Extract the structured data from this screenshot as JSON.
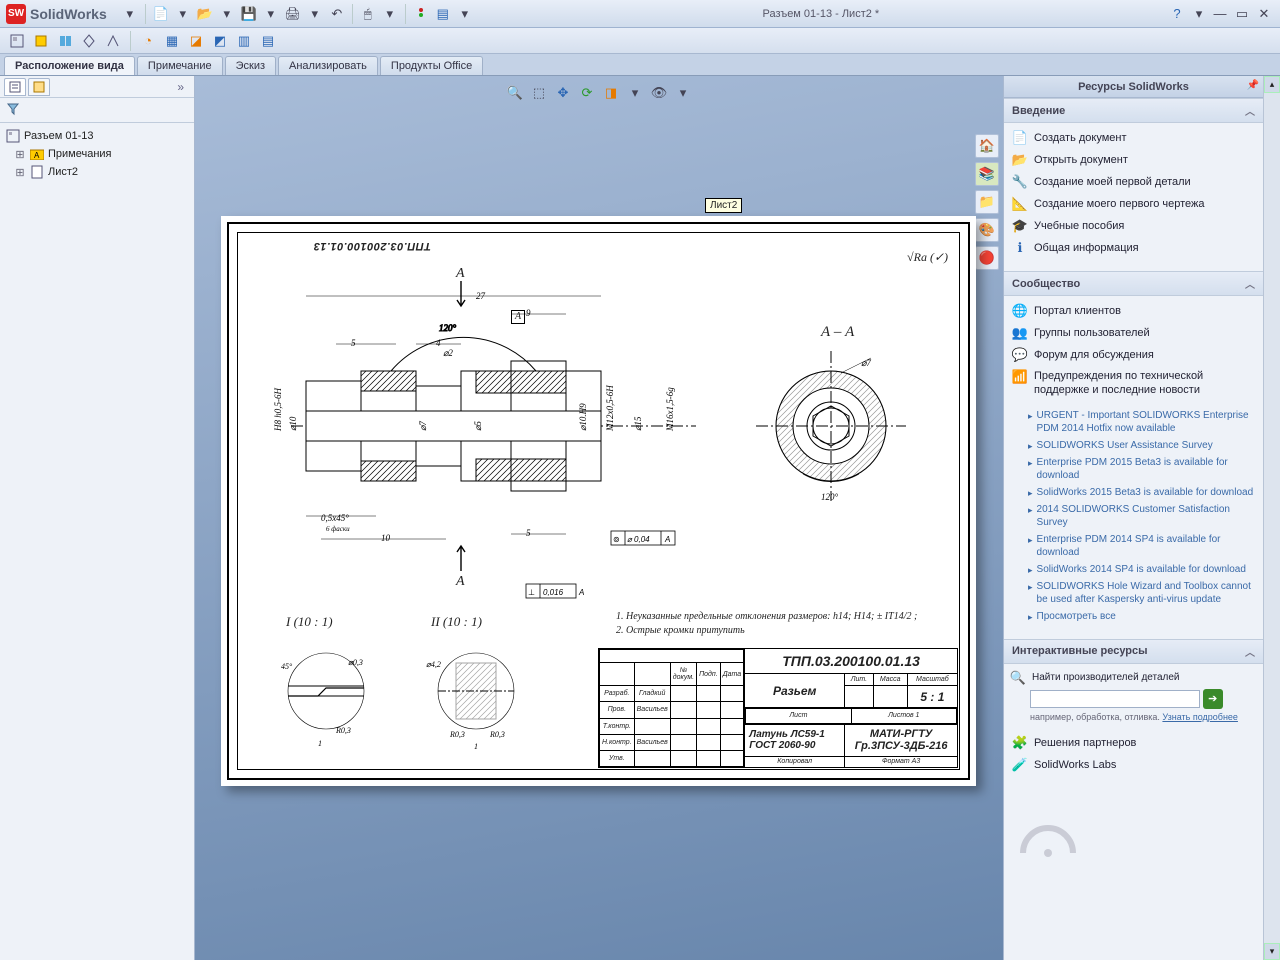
{
  "app": {
    "logo_letters": "SW",
    "brand": "SolidWorks",
    "window_title": "Разъем 01-13 - Лист2 *"
  },
  "tabs": {
    "t1": "Расположение вида",
    "t2": "Примечание",
    "t3": "Эскиз",
    "t4": "Анализировать",
    "t5": "Продукты Office"
  },
  "tree": {
    "root": "Разъем 01-13",
    "ann": "Примечания",
    "sheet": "Лист2",
    "tooltip": "Лист2"
  },
  "resources": {
    "title": "Ресурсы SolidWorks",
    "intro_hdr": "Введение",
    "intro_items": {
      "i1": "Создать документ",
      "i2": "Открыть документ",
      "i3": "Создание моей первой детали",
      "i4": "Создание моего первого чертежа",
      "i5": "Учебные пособия",
      "i6": "Общая информация"
    },
    "community_hdr": "Сообщество",
    "community_items": {
      "c1": "Портал клиентов",
      "c2": "Группы пользователей",
      "c3": "Форум для обсуждения",
      "c4": "Предупреждения по технической поддержке и последние новости"
    },
    "news": {
      "n1": "URGENT - Important SOLIDWORKS Enterprise PDM 2014 Hotfix now available",
      "n2": "SOLIDWORKS User Assistance Survey",
      "n3": "Enterprise PDM 2015 Beta3 is available for download",
      "n4": "SolidWorks 2015 Beta3 is available for download",
      "n5": "2014 SOLIDWORKS Customer Satisfaction Survey",
      "n6": "Enterprise PDM 2014 SP4 is available for download",
      "n7": "SolidWorks 2014 SP4 is available for download",
      "n8": "SOLIDWORKS Hole Wizard and Toolbox cannot be used after Kaspersky anti-virus update",
      "view_all": "Просмотреть все"
    },
    "interactive_hdr": "Интерактивные ресурсы",
    "search_label": "Найти производителей деталей",
    "search_hint_prefix": "например, обработка, отливка. ",
    "search_hint_link": "Узнать подробнее",
    "partner": "Решения партнеров",
    "labs": "SolidWorks Labs"
  },
  "drawing": {
    "part_code_rev": "ТПП.03.200100.01.13",
    "section_AA": "А – А",
    "section_A_top": "А",
    "section_A_bot": "А",
    "detail1": "I   (10 : 1)",
    "detail2": "II   (10 : 1)",
    "note1": "1. Неуказанные предельные отклонения размеров: h14; H14; ± IT14/2 ;",
    "note2": "2. Острые кромки притупить",
    "surface_sym": "√Ra  (✓)",
    "titleblock": {
      "code": "ТПП.03.200100.01.13",
      "name": "Разьем",
      "scale": "5 : 1",
      "material1": "Латунь ЛС59-1",
      "material2": "ГОСТ 2060-90",
      "org1": "МАТИ-РГТУ",
      "org2": "Гр.3ПСУ-3ДБ-216",
      "role1": "Разраб.",
      "role2": "Пров.",
      "person": "Гладкий",
      "person2": "Васильев",
      "headers": {
        "lit": "Лит.",
        "massa": "Масса",
        "scale": "Масштаб"
      },
      "footer": "Формат А3"
    }
  }
}
